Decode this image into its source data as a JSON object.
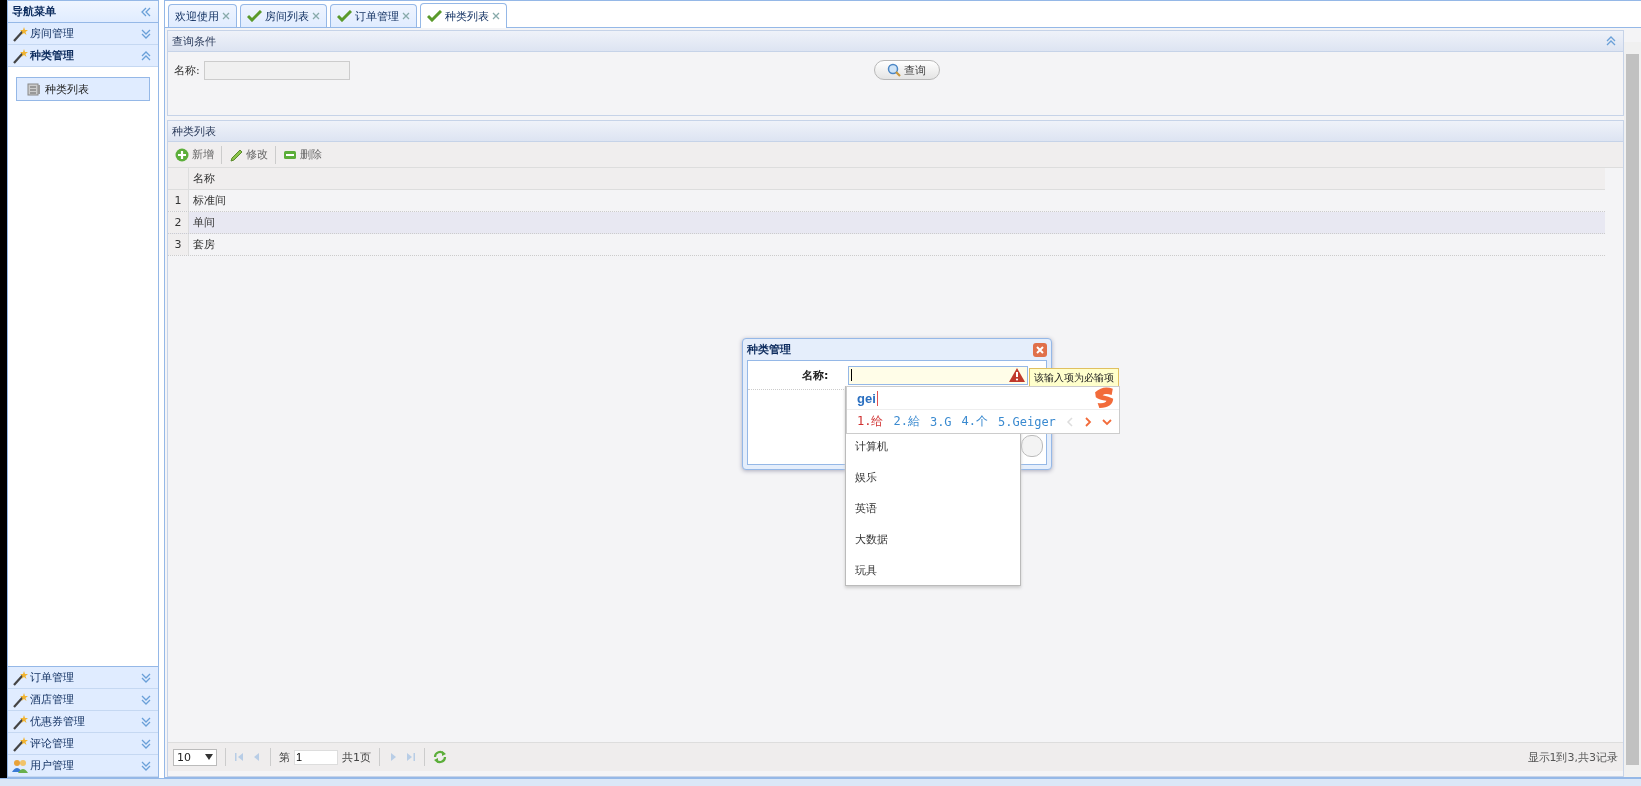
{
  "sidebar": {
    "title": "导航菜单",
    "sections": [
      {
        "label": "房间管理",
        "kind": "wand",
        "expanded": false
      },
      {
        "label": "种类管理",
        "kind": "wand",
        "expanded": true,
        "items": [
          {
            "label": "种类列表",
            "selected": true
          }
        ]
      },
      {
        "label": "订单管理",
        "kind": "wand",
        "expanded": false
      },
      {
        "label": "酒店管理",
        "kind": "wand",
        "expanded": false
      },
      {
        "label": "优惠券管理",
        "kind": "wand",
        "expanded": false
      },
      {
        "label": "评论管理",
        "kind": "wand",
        "expanded": false
      },
      {
        "label": "用户管理",
        "kind": "users",
        "expanded": false
      }
    ]
  },
  "tabs": [
    {
      "label": "欢迎使用",
      "kind": "plain",
      "selected": false
    },
    {
      "label": "房间列表",
      "kind": "check",
      "selected": false
    },
    {
      "label": "订单管理",
      "kind": "check",
      "selected": false
    },
    {
      "label": "种类列表",
      "kind": "check",
      "selected": true
    }
  ],
  "query_panel": {
    "title": "查询条件",
    "field_label": "名称:",
    "button": "查询"
  },
  "list_panel": {
    "title": "种类列表",
    "toolbar": [
      {
        "label": "新增",
        "kind": "add"
      },
      {
        "label": "修改",
        "kind": "edit"
      },
      {
        "label": "删除",
        "kind": "remove"
      }
    ],
    "columns": [
      "名称"
    ],
    "rows": [
      {
        "number": "1",
        "name": "标准间",
        "selected": false
      },
      {
        "number": "2",
        "name": "单间",
        "selected": true
      },
      {
        "number": "3",
        "name": "套房",
        "selected": false
      }
    ],
    "pager": {
      "page_size": "10",
      "page_prefix": "第",
      "page": "1",
      "page_total": "共1页",
      "summary": "显示1到3,共3记录"
    }
  },
  "dialog": {
    "title": "种类管理",
    "field_label": "名称:",
    "error_tip": "该输入项为必输项",
    "options": [
      "计算机",
      "娱乐",
      "英语",
      "大数据",
      "玩具"
    ]
  },
  "ime": {
    "composition": "gei",
    "candidates": [
      {
        "text": "1.给",
        "selected": true
      },
      {
        "text": "2.給",
        "selected": false
      },
      {
        "text": "3.G",
        "selected": false
      },
      {
        "text": "4.个",
        "selected": false
      },
      {
        "text": "5.Geiger",
        "selected": false
      }
    ]
  }
}
